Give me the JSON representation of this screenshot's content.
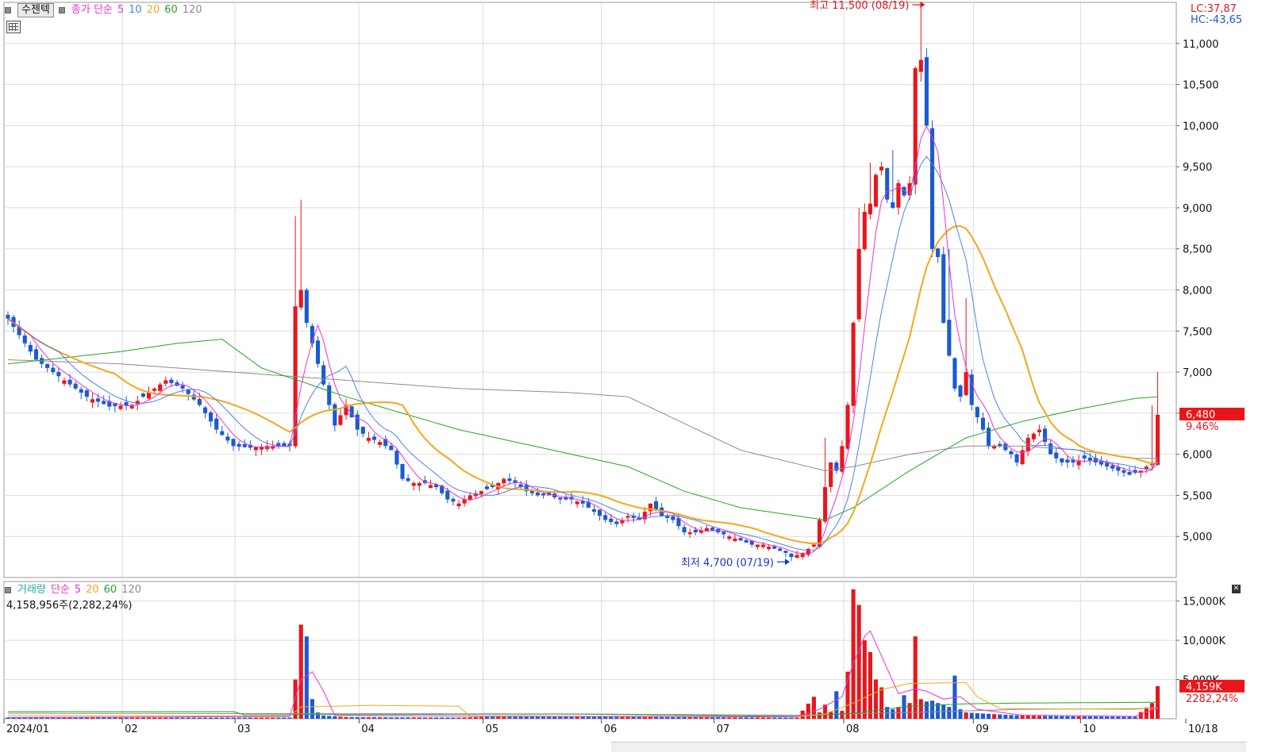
{
  "toolbar": {
    "main_toggle": "수젠텍",
    "price_label": "종가 단순",
    "ma_periods": [
      "5",
      "10",
      "20",
      "60",
      "120"
    ],
    "volume_label": "거래량",
    "volume_ma_label": "단순",
    "volume_ma_periods": [
      "5",
      "20",
      "60",
      "120"
    ],
    "volume_value": "4,158,956주(2,282,24%)",
    "lc": "LC:37,87",
    "hc": "HC:-43,65",
    "grid_icon": "table-grid-icon",
    "close_icon": "close-icon"
  },
  "colors": {
    "up": "#e8161b",
    "down": "#1a5bd0",
    "ma5": "#f030d0",
    "ma10": "#4f7ff0",
    "ma20": "#f2a81c",
    "ma60": "#25a325",
    "ma120": "#8c8c8c",
    "high_marker": "#e8161b",
    "low_marker": "#1a2fd0"
  },
  "chart_data": [
    {
      "type": "candlestick",
      "title": "",
      "y_ticks": [
        "5,000",
        "5,500",
        "6,000",
        "6,500",
        "7,000",
        "7,500",
        "8,000",
        "8,500",
        "9,000",
        "9,500",
        "10,000",
        "10,500",
        "11,000"
      ],
      "y_tick_values": [
        5000,
        5500,
        6000,
        6500,
        7000,
        7500,
        8000,
        8500,
        9000,
        9500,
        10000,
        10500,
        11000
      ],
      "ylim": [
        4500,
        11500
      ],
      "x_labels": [
        "2024/01",
        "02",
        "03",
        "04",
        "05",
        "06",
        "07",
        "08",
        "09",
        "10",
        "10/18"
      ],
      "x_label_index": [
        0,
        21,
        41,
        63,
        85,
        106,
        126,
        149,
        172,
        191,
        205
      ],
      "n": 205,
      "annotations": {
        "high": {
          "text": "최고 11,500 (08/19)",
          "value": 11500,
          "index": 163
        },
        "low": {
          "text": "최저 4,700 (07/19)",
          "value": 4700,
          "index": 139
        }
      },
      "last_price_label": "6,480",
      "last_change_label": "9.46%",
      "knots": [
        [
          0,
          7650
        ],
        [
          5,
          7150
        ],
        [
          10,
          6900
        ],
        [
          14,
          6700
        ],
        [
          18,
          6580
        ],
        [
          22,
          6600
        ],
        [
          25,
          6750
        ],
        [
          28,
          6900
        ],
        [
          31,
          6800
        ],
        [
          34,
          6600
        ],
        [
          37,
          6300
        ],
        [
          40,
          6100
        ],
        [
          43,
          6080
        ],
        [
          46,
          6100
        ],
        [
          49,
          6100
        ],
        [
          50,
          6100
        ],
        [
          51,
          7800
        ],
        [
          52,
          8000
        ],
        [
          53,
          7600
        ],
        [
          55,
          7100
        ],
        [
          57,
          6600
        ],
        [
          58,
          6350
        ],
        [
          60,
          6600
        ],
        [
          62,
          6300
        ],
        [
          64,
          6200
        ],
        [
          66,
          6150
        ],
        [
          68,
          6050
        ],
        [
          70,
          5700
        ],
        [
          72,
          5650
        ],
        [
          74,
          5650
        ],
        [
          76,
          5600
        ],
        [
          78,
          5450
        ],
        [
          80,
          5400
        ],
        [
          82,
          5500
        ],
        [
          84,
          5550
        ],
        [
          86,
          5600
        ],
        [
          88,
          5700
        ],
        [
          90,
          5650
        ],
        [
          92,
          5550
        ],
        [
          94,
          5500
        ],
        [
          96,
          5500
        ],
        [
          98,
          5450
        ],
        [
          100,
          5450
        ],
        [
          102,
          5400
        ],
        [
          104,
          5300
        ],
        [
          106,
          5200
        ],
        [
          108,
          5150
        ],
        [
          110,
          5250
        ],
        [
          112,
          5200
        ],
        [
          114,
          5400
        ],
        [
          116,
          5250
        ],
        [
          118,
          5200
        ],
        [
          120,
          5050
        ],
        [
          122,
          5050
        ],
        [
          124,
          5100
        ],
        [
          126,
          5050
        ],
        [
          128,
          5000
        ],
        [
          130,
          4950
        ],
        [
          132,
          4900
        ],
        [
          134,
          4900
        ],
        [
          136,
          4850
        ],
        [
          138,
          4800
        ],
        [
          139,
          4750
        ],
        [
          141,
          4800
        ],
        [
          143,
          4900
        ],
        [
          144,
          5200
        ],
        [
          145,
          5600
        ],
        [
          146,
          5900
        ],
        [
          147,
          5800
        ],
        [
          148,
          6100
        ],
        [
          149,
          6600
        ],
        [
          150,
          7600
        ],
        [
          151,
          8500
        ],
        [
          152,
          8950
        ],
        [
          153,
          9050
        ],
        [
          154,
          9400
        ],
        [
          155,
          9500
        ],
        [
          156,
          9100
        ],
        [
          157,
          9000
        ],
        [
          158,
          9300
        ],
        [
          159,
          9150
        ],
        [
          160,
          9300
        ],
        [
          161,
          10700
        ],
        [
          162,
          10800
        ],
        [
          163,
          10000
        ],
        [
          164,
          8500
        ],
        [
          165,
          8400
        ],
        [
          166,
          7600
        ],
        [
          167,
          7200
        ],
        [
          168,
          6800
        ],
        [
          169,
          6700
        ],
        [
          170,
          7000
        ],
        [
          171,
          6600
        ],
        [
          172,
          6450
        ],
        [
          173,
          6300
        ],
        [
          174,
          6100
        ],
        [
          176,
          6100
        ],
        [
          178,
          6000
        ],
        [
          179,
          5900
        ],
        [
          181,
          6200
        ],
        [
          183,
          6300
        ],
        [
          185,
          6000
        ],
        [
          187,
          5900
        ],
        [
          189,
          5900
        ],
        [
          191,
          5950
        ],
        [
          193,
          5900
        ],
        [
          195,
          5850
        ],
        [
          197,
          5800
        ],
        [
          199,
          5750
        ],
        [
          201,
          5800
        ],
        [
          203,
          5900
        ],
        [
          204,
          6480
        ]
      ],
      "ma120_knots": [
        [
          0,
          7150
        ],
        [
          20,
          7100
        ],
        [
          40,
          7000
        ],
        [
          60,
          6900
        ],
        [
          80,
          6800
        ],
        [
          100,
          6750
        ],
        [
          110,
          6700
        ],
        [
          130,
          6050
        ],
        [
          145,
          5800
        ],
        [
          150,
          5850
        ],
        [
          160,
          6000
        ],
        [
          170,
          6100
        ],
        [
          180,
          6100
        ],
        [
          190,
          6050
        ],
        [
          200,
          5950
        ],
        [
          204,
          5950
        ]
      ],
      "ma60_knots": [
        [
          0,
          7100
        ],
        [
          20,
          7250
        ],
        [
          30,
          7350
        ],
        [
          38,
          7400
        ],
        [
          45,
          7050
        ],
        [
          60,
          6700
        ],
        [
          80,
          6300
        ],
        [
          100,
          6000
        ],
        [
          110,
          5850
        ],
        [
          120,
          5550
        ],
        [
          130,
          5350
        ],
        [
          145,
          5200
        ],
        [
          150,
          5350
        ],
        [
          160,
          5800
        ],
        [
          170,
          6200
        ],
        [
          180,
          6400
        ],
        [
          190,
          6550
        ],
        [
          200,
          6680
        ],
        [
          204,
          6700
        ]
      ]
    },
    {
      "type": "bar",
      "title": "",
      "y_ticks": [
        "5,000K",
        "10,000K",
        "15,000K"
      ],
      "y_tick_values": [
        5000,
        10000,
        15000
      ],
      "ylim": [
        0,
        17500
      ],
      "unit": "K shares",
      "last_volume_label": "4,159K",
      "last_volume_change_label": "2282,24%",
      "knots": [
        [
          0,
          150
        ],
        [
          50,
          150
        ],
        [
          51,
          5000
        ],
        [
          52,
          12000
        ],
        [
          53,
          10500
        ],
        [
          54,
          2500
        ],
        [
          55,
          800
        ],
        [
          56,
          400
        ],
        [
          60,
          200
        ],
        [
          80,
          150
        ],
        [
          90,
          350
        ],
        [
          100,
          300
        ],
        [
          110,
          250
        ],
        [
          120,
          200
        ],
        [
          140,
          150
        ],
        [
          143,
          2800
        ],
        [
          144,
          800
        ],
        [
          145,
          1800
        ],
        [
          146,
          900
        ],
        [
          147,
          3500
        ],
        [
          148,
          1000
        ],
        [
          149,
          6000
        ],
        [
          150,
          16500
        ],
        [
          151,
          14500
        ],
        [
          152,
          10000
        ],
        [
          153,
          8500
        ],
        [
          154,
          5000
        ],
        [
          155,
          4000
        ],
        [
          156,
          1500
        ],
        [
          157,
          1200
        ],
        [
          158,
          1500
        ],
        [
          159,
          3000
        ],
        [
          160,
          2000
        ],
        [
          161,
          10500
        ],
        [
          162,
          2500
        ],
        [
          163,
          2200
        ],
        [
          164,
          2300
        ],
        [
          165,
          2000
        ],
        [
          166,
          1800
        ],
        [
          167,
          1500
        ],
        [
          168,
          5500
        ],
        [
          169,
          1200
        ],
        [
          170,
          800
        ],
        [
          172,
          700
        ],
        [
          180,
          400
        ],
        [
          190,
          300
        ],
        [
          200,
          250
        ],
        [
          203,
          2000
        ],
        [
          204,
          4159
        ]
      ],
      "ma5_overlay_knots": [
        [
          0,
          150
        ],
        [
          50,
          300
        ],
        [
          52,
          5000
        ],
        [
          54,
          6000
        ],
        [
          56,
          3500
        ],
        [
          58,
          400
        ],
        [
          100,
          300
        ],
        [
          140,
          250
        ],
        [
          144,
          1200
        ],
        [
          148,
          2800
        ],
        [
          150,
          7000
        ],
        [
          152,
          10500
        ],
        [
          153,
          11200
        ],
        [
          155,
          8000
        ],
        [
          158,
          3200
        ],
        [
          161,
          3800
        ],
        [
          163,
          3500
        ],
        [
          166,
          2500
        ],
        [
          169,
          2800
        ],
        [
          172,
          1200
        ],
        [
          180,
          450
        ],
        [
          200,
          300
        ],
        [
          204,
          1400
        ]
      ],
      "ma20_overlay_knots": [
        [
          0,
          400
        ],
        [
          50,
          350
        ],
        [
          52,
          1500
        ],
        [
          64,
          1700
        ],
        [
          80,
          1600
        ],
        [
          82,
          300
        ],
        [
          140,
          250
        ],
        [
          145,
          600
        ],
        [
          150,
          2000
        ],
        [
          155,
          3700
        ],
        [
          160,
          4500
        ],
        [
          170,
          4600
        ],
        [
          172,
          2800
        ],
        [
          176,
          1300
        ],
        [
          200,
          1200
        ],
        [
          204,
          1400
        ]
      ],
      "ma60_overlay_knots": [
        [
          0,
          900
        ],
        [
          40,
          900
        ],
        [
          42,
          500
        ],
        [
          100,
          600
        ],
        [
          140,
          300
        ],
        [
          150,
          700
        ],
        [
          160,
          1600
        ],
        [
          170,
          1900
        ],
        [
          180,
          2000
        ],
        [
          204,
          2100
        ]
      ],
      "ma120_overlay_knots": [
        [
          0,
          700
        ],
        [
          100,
          600
        ],
        [
          140,
          450
        ],
        [
          160,
          800
        ],
        [
          180,
          1200
        ],
        [
          204,
          1300
        ]
      ]
    }
  ]
}
